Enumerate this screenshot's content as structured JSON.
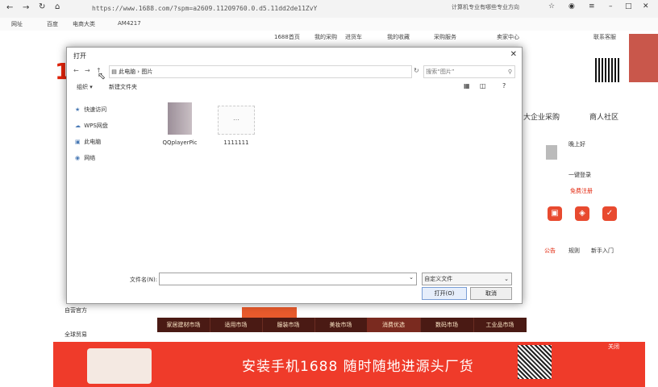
{
  "browser": {
    "url": "https://www.1688.com/?spm=a2609.11209760.0.d5.11dd2de11ZvY",
    "search_hint": "计算机专业有哪些专业方向",
    "bookmarks": [
      "网址",
      "百度",
      "电商大类",
      "AM4217"
    ]
  },
  "site_nav": [
    "1688首页",
    "我的采购",
    "进货车",
    "我的收藏",
    "采购服务",
    "卖家中心",
    "联系客服"
  ],
  "site": {
    "logo": "16",
    "right_links": [
      "大企业采购",
      "商人社区"
    ],
    "greeting": "晚上好",
    "login_link": "一键登录",
    "register_link": "免费注册",
    "tabs": [
      "公告",
      "规则",
      "新手入门"
    ],
    "categories": [
      "家居建材市场",
      "适用市场",
      "服装市场",
      "美妆市场",
      "消费优选",
      "数码市场",
      "工业品市场"
    ],
    "left_bottom": [
      "自营官方",
      "全球贸易"
    ],
    "banner_text": "安装手机1688  随时随地进源头厂货",
    "banner_close": "关闭"
  },
  "dialog": {
    "title": "打开",
    "close": "✕",
    "path": "此电脑 › 图片",
    "search_placeholder": "搜索“图片”",
    "organize": "组织 ▾",
    "new_folder": "新建文件夹",
    "sidebar": [
      {
        "label": "快速访问",
        "icon": "star-icon"
      },
      {
        "label": "WPS网盘",
        "icon": "cloud-icon"
      },
      {
        "label": "此电脑",
        "icon": "computer-icon"
      },
      {
        "label": "网络",
        "icon": "network-icon"
      }
    ],
    "files": [
      {
        "name": "QQplayerPic",
        "type": "folder"
      },
      {
        "name": "1111111",
        "type": "image"
      }
    ],
    "filename_label": "文件名(N):",
    "filename_value": "",
    "filetype": "自定义文件",
    "open_label": "打开(O)",
    "cancel_label": "取消"
  }
}
